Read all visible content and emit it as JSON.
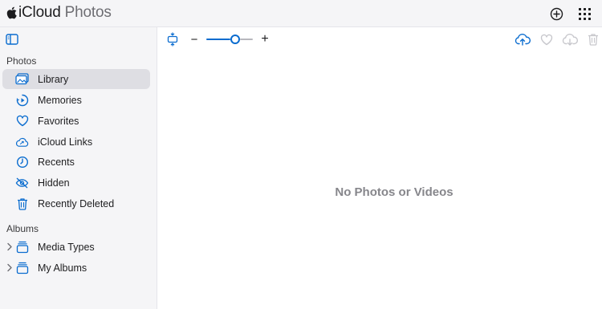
{
  "header": {
    "brand_primary": "iCloud",
    "brand_secondary": "Photos",
    "icons": {
      "add": "plus-circle-icon",
      "apps": "grid-icon"
    }
  },
  "sidebar": {
    "toggle_icon": "sidebar-toggle-icon",
    "sections": {
      "photos": {
        "title": "Photos",
        "items": [
          {
            "label": "Library",
            "icon": "library-icon",
            "active": true
          },
          {
            "label": "Memories",
            "icon": "memories-icon",
            "active": false
          },
          {
            "label": "Favorites",
            "icon": "heart-icon",
            "active": false
          },
          {
            "label": "iCloud Links",
            "icon": "cloud-link-icon",
            "active": false
          },
          {
            "label": "Recents",
            "icon": "clock-icon",
            "active": false
          },
          {
            "label": "Hidden",
            "icon": "eye-slash-icon",
            "active": false
          },
          {
            "label": "Recently Deleted",
            "icon": "trash-icon",
            "active": false
          }
        ]
      },
      "albums": {
        "title": "Albums",
        "items": [
          {
            "label": "Media Types",
            "icon": "album-stack-icon",
            "expandable": true
          },
          {
            "label": "My Albums",
            "icon": "album-stack-icon",
            "expandable": true
          }
        ]
      }
    }
  },
  "toolbar": {
    "zoom_out_label": "−",
    "zoom_in_label": "+",
    "zoom_level": 0.65,
    "icons": [
      "aspect-toggle-icon",
      "upload-icon",
      "favorite-icon",
      "download-icon",
      "delete-icon"
    ]
  },
  "main": {
    "empty_message": "No Photos or Videos"
  },
  "colors": {
    "accent": "#0a6ccf",
    "sidebar_bg": "#f5f5f7",
    "active_bg": "#dedee3",
    "disabled": "#c7c7cc",
    "empty_text": "#86868b"
  }
}
